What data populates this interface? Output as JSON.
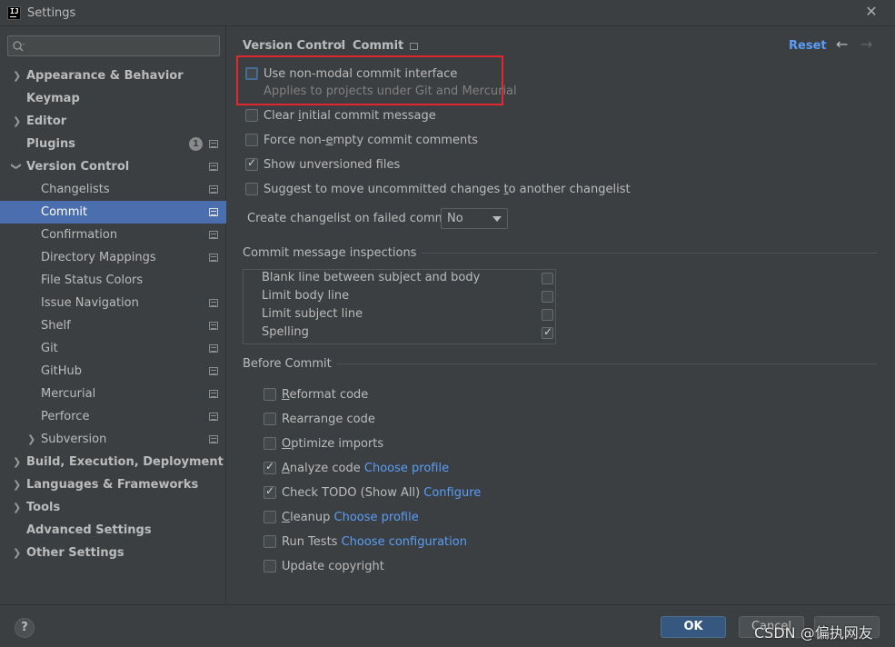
{
  "window": {
    "title": "Settings"
  },
  "search": {
    "placeholder": ""
  },
  "sidebar": {
    "items": [
      {
        "label": "Appearance & Behavior"
      },
      {
        "label": "Keymap"
      },
      {
        "label": "Editor"
      },
      {
        "label": "Plugins",
        "badge": "1"
      },
      {
        "label": "Version Control"
      },
      {
        "label": "Changelists"
      },
      {
        "label": "Commit"
      },
      {
        "label": "Confirmation"
      },
      {
        "label": "Directory Mappings"
      },
      {
        "label": "File Status Colors"
      },
      {
        "label": "Issue Navigation"
      },
      {
        "label": "Shelf"
      },
      {
        "label": "Git"
      },
      {
        "label": "GitHub"
      },
      {
        "label": "Mercurial"
      },
      {
        "label": "Perforce"
      },
      {
        "label": "Subversion"
      },
      {
        "label": "Build, Execution, Deployment"
      },
      {
        "label": "Languages & Frameworks"
      },
      {
        "label": "Tools"
      },
      {
        "label": "Advanced Settings"
      },
      {
        "label": "Other Settings"
      }
    ],
    "selected": "Commit"
  },
  "header": {
    "breadcrumb": [
      "Version Control",
      "Commit"
    ],
    "reset_label": "Reset"
  },
  "options": {
    "non_modal": {
      "label": "Use non-modal commit interface",
      "sub": "Applies to projects under Git and Mercurial",
      "checked": false
    },
    "clear_initial": {
      "label_pre": "Clear ",
      "label_ul": "i",
      "label_post": "nitial commit message",
      "checked": false
    },
    "force_nonempty": {
      "label_pre": "Force non-",
      "label_ul": "e",
      "label_post": "mpty commit comments",
      "checked": false
    },
    "show_unversioned": {
      "label": "Show unversioned files",
      "checked": true
    },
    "suggest_move": {
      "label_pre": "Suggest to move uncommitted changes ",
      "label_ul": "t",
      "label_post": "o another changelist",
      "checked": false
    },
    "failed_commit": {
      "label": "Create changelist on failed commit:",
      "value": "No"
    }
  },
  "inspections": {
    "title": "Commit message inspections",
    "rows": [
      {
        "label": "Blank line between subject and body",
        "checked": false
      },
      {
        "label": "Limit body line",
        "checked": false
      },
      {
        "label": "Limit subject line",
        "checked": false
      },
      {
        "label": "Spelling",
        "checked": true
      }
    ]
  },
  "before_commit": {
    "title": "Before Commit",
    "reformat": {
      "label_ul": "R",
      "label_post": "eformat code",
      "checked": false
    },
    "rearrange": {
      "label_pre": "Rearran",
      "label_ul": "g",
      "label_post": "e code",
      "checked": false
    },
    "optimize": {
      "label_ul": "O",
      "label_post": "ptimize imports",
      "checked": false
    },
    "analyze": {
      "label_ul": "A",
      "label_post": "nalyze code",
      "link": "Choose profile",
      "checked": true
    },
    "check_todo": {
      "label": "Check TODO (Show All)",
      "link": "Configure",
      "checked": true
    },
    "cleanup": {
      "label_ul": "C",
      "label_post": "leanup",
      "link": "Choose profile",
      "checked": false
    },
    "run_tests": {
      "label": "Run Tests",
      "link": "Choose configuration",
      "checked": false
    },
    "update_copyright": {
      "label": "Update copyright",
      "checked": false
    }
  },
  "footer": {
    "help": "?",
    "ok": "OK",
    "cancel": "Cancel",
    "watermark": "CSDN @偏执网友"
  },
  "colors": {
    "accent": "#589df6",
    "selection": "#4b6eaf",
    "highlight_box": "#e0282e",
    "ok_button": "#365880"
  }
}
